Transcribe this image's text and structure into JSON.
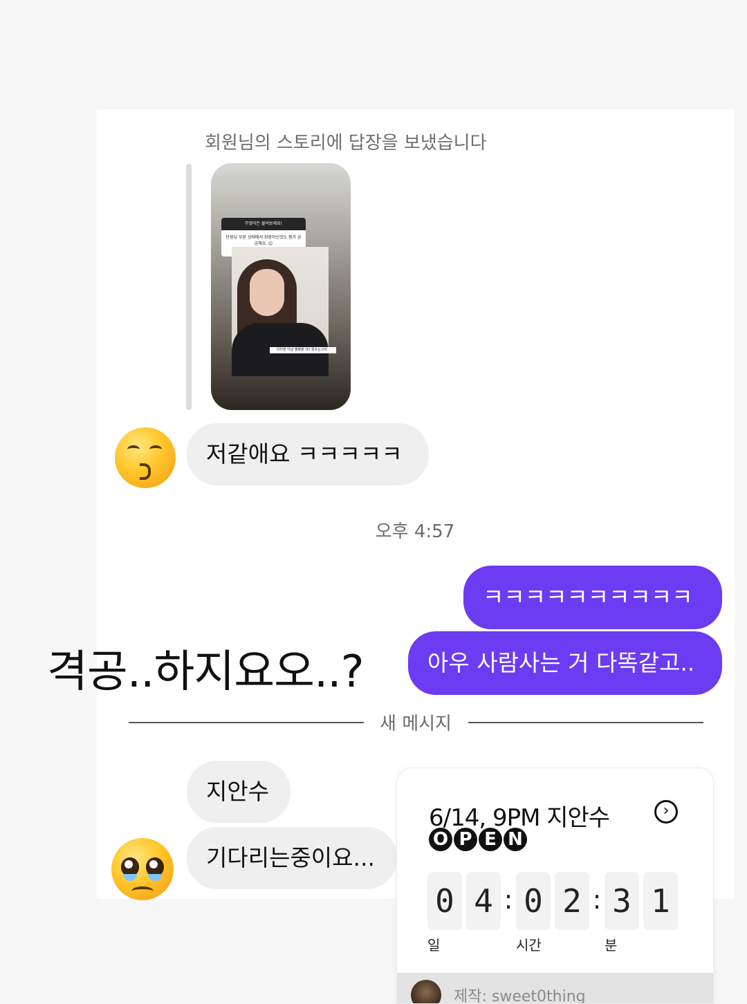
{
  "story_reply": {
    "label": "회원님의 스토리에 답장을 보냈습니다",
    "story_question_title": "무엇이든 물어보세요!",
    "story_question_text": "단원님 부른 상태에서 화장하신것도 뭔가 궁금해요..😊",
    "story_caption": "이리면 이날 찡병분 (5) 못쓰는고야.."
  },
  "messages": {
    "in_1": "저같애요 ㅋㅋㅋㅋㅋ",
    "timestamp": "오후 4:57",
    "out_1": "ㅋㅋㅋㅋㅋㅋㅋㅋㅋㅋ",
    "out_2": "아우 사람사는 거 다똑같고..",
    "divider": "새 메시지",
    "in_2": "지안수",
    "in_3": "기다리는중이요..."
  },
  "overlay_caption": "격공..하지요오..?",
  "countdown": {
    "title": "6/14, 9PM 지안수",
    "open_letters": [
      "O",
      "P",
      "E",
      "N"
    ],
    "digits": [
      "0",
      "4",
      "0",
      "2",
      "3",
      "1"
    ],
    "separator": ":",
    "units": [
      "일",
      "시간",
      "분"
    ],
    "footer_text": "제작: sweet0thing"
  },
  "icons": {
    "avatar_1": "kissing-smiling-eyes-emoji",
    "avatar_2": "pleading-face-emoji",
    "countdown_arrow": "chevron-right-circle-icon"
  },
  "colors": {
    "outgoing_bubble": "#6b3cf2",
    "incoming_bubble": "#efefef"
  }
}
